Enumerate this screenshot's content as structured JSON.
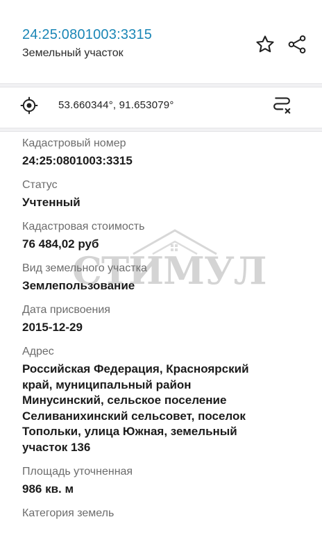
{
  "header": {
    "title": "24:25:0801003:3315",
    "subtitle": "Земельный участок",
    "icons": {
      "favorite": "star-icon",
      "share": "share-icon"
    }
  },
  "coords": {
    "text": "53.660344°, 91.653079°",
    "icons": {
      "locate": "locate-icon",
      "route": "route-icon"
    }
  },
  "fields": [
    {
      "label": "Кадастровый номер",
      "value": "24:25:0801003:3315"
    },
    {
      "label": "Статус",
      "value": "Учтенный"
    },
    {
      "label": "Кадастровая стоимость",
      "value": "76 484,02 руб"
    },
    {
      "label": "Вид земельного участка",
      "value": "Землепользование"
    },
    {
      "label": "Дата присвоения",
      "value": "2015-12-29"
    },
    {
      "label": "Адрес",
      "value_lines": [
        "Российская Федерация, Красноярский",
        "край, муниципальный район",
        "Минусинский, сельское поселение",
        "Селиванихинский сельсовет, поселок",
        "Топольки, улица Южная, земельный",
        "участок 136"
      ]
    },
    {
      "label": "Площадь уточненная",
      "value": "986 кв. м"
    },
    {
      "label": "Категория земель",
      "value": ""
    }
  ],
  "watermark": {
    "text": "СТИМУЛ"
  },
  "colors": {
    "title": "#1a86b6",
    "label": "#6c6c6c",
    "value": "#1b1b1b",
    "divider": "#f1f1f3"
  }
}
